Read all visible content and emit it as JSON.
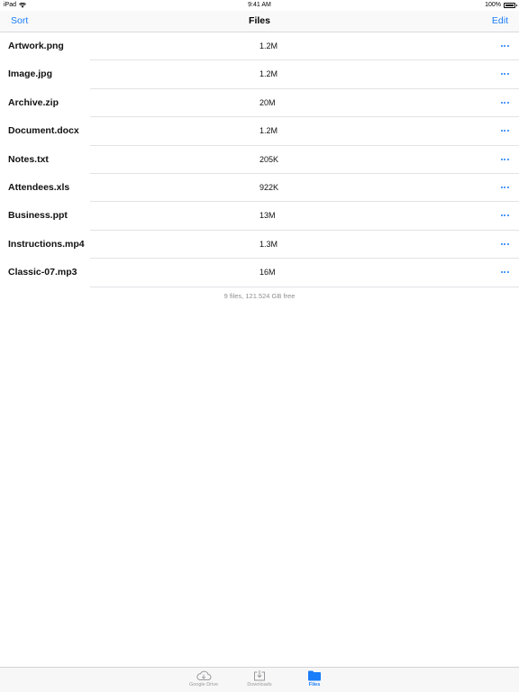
{
  "status_bar": {
    "device": "iPad",
    "time": "9:41 AM",
    "battery": "100%"
  },
  "nav": {
    "left_label": "Sort",
    "title": "Files",
    "right_label": "Edit"
  },
  "files": [
    {
      "name": "Artwork.png",
      "size": "1.2M"
    },
    {
      "name": "Image.jpg",
      "size": "1.2M"
    },
    {
      "name": "Archive.zip",
      "size": "20M"
    },
    {
      "name": "Document.docx",
      "size": "1.2M"
    },
    {
      "name": "Notes.txt",
      "size": "205K"
    },
    {
      "name": "Attendees.xls",
      "size": "922K"
    },
    {
      "name": "Business.ppt",
      "size": "13M"
    },
    {
      "name": "Instructions.mp4",
      "size": "1.3M"
    },
    {
      "name": "Classic-07.mp3",
      "size": "16M"
    }
  ],
  "footer": "9 files, 121.524 GB free",
  "tabs": [
    {
      "label": "Google Drive",
      "icon": "cloud-icon",
      "active": false
    },
    {
      "label": "Downloads",
      "icon": "download-tray-icon",
      "active": false
    },
    {
      "label": "Files",
      "icon": "folder-icon",
      "active": true
    }
  ],
  "colors": {
    "accent": "#1a7dfa",
    "separator": "#e3e3e6",
    "secondary_text": "#8e8e93"
  }
}
